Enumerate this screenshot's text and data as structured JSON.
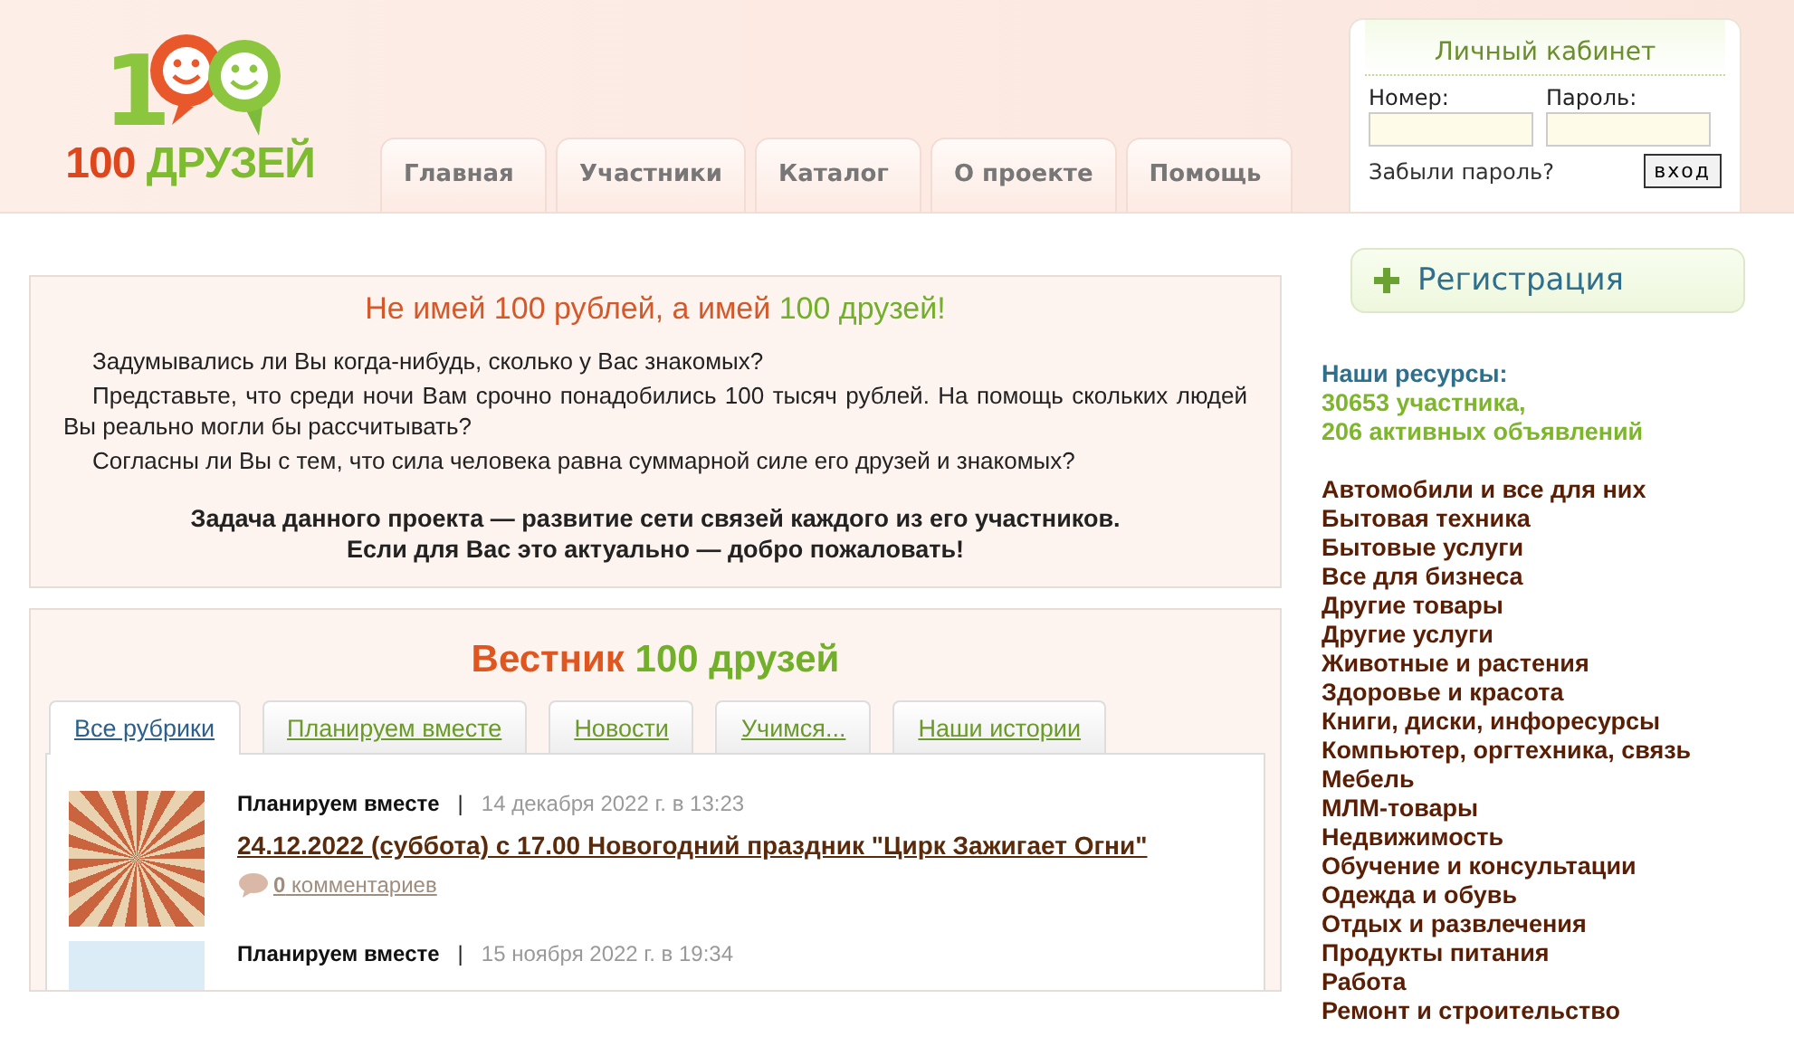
{
  "logo": {
    "mark": "1",
    "number": "100",
    "word": "ДРУЗЕЙ"
  },
  "nav": [
    {
      "label": "Главная",
      "selected": false
    },
    {
      "label": "Участники",
      "selected": false
    },
    {
      "label": "Каталог",
      "selected": false
    },
    {
      "label": "О проекте",
      "selected": false
    },
    {
      "label": "Помощь",
      "selected": false
    }
  ],
  "login": {
    "title": "Личный кабинет",
    "number_label": "Номер:",
    "password_label": "Пароль:",
    "forgot": "Забыли пароль?",
    "submit": "вход"
  },
  "intro": {
    "title": [
      {
        "kind": "accent",
        "text": "Не имей 100 рублей, а имей "
      },
      {
        "kind": "brand",
        "text": "100 друзей!"
      }
    ],
    "paragraphs": [
      "Задумывались ли Вы когда-нибудь, сколько у Вас знакомых?",
      "Представьте, что среди ночи Вам срочно понадобились 100 тысяч рублей. На помощь скольких людей Вы реально могли бы рассчитывать?",
      "Согласны ли Вы с тем, что сила человека равна суммарной силе его друзей и знакомых?"
    ],
    "mission": [
      "Задача данного проекта — развитие сети связей каждого из его участников.",
      "Если для Вас это актуально — добро пожаловать!"
    ]
  },
  "news": {
    "title": [
      {
        "kind": "accent",
        "text": "Вестник "
      },
      {
        "kind": "brand",
        "text": "100 друзей"
      }
    ],
    "tabs": [
      {
        "label": "Все рубрики",
        "selected": true
      },
      {
        "label": "Планируем вместе",
        "selected": false
      },
      {
        "label": "Новости",
        "selected": false
      },
      {
        "label": "Учимся...",
        "selected": false
      },
      {
        "label": "Наши истории",
        "selected": false
      }
    ],
    "items": [
      {
        "category": "Планируем вместе",
        "separator": "|",
        "date": "14 декабря 2022 г. в 13:23",
        "title": "24.12.2022 (суббота) с 17.00 Новогодний праздник \"Цирк Зажигает Огни\"",
        "comment_count": "0",
        "comment_word": " комментариев"
      },
      {
        "category": "Планируем вместе",
        "separator": "|",
        "date": "15 ноября 2022 г. в 19:34"
      }
    ]
  },
  "register": {
    "label": "Регистрация"
  },
  "resources": {
    "title": "Наши ресурсы:",
    "stats": [
      "30653 участника,",
      "206 активных объявлений"
    ],
    "categories": [
      "Автомобили и все для них",
      "Бытовая техника",
      "Бытовые услуги",
      "Все для бизнеса",
      "Другие товары",
      "Другие услуги",
      "Животные и растения",
      "Здоровье и красота",
      "Книги, диски, инфоресурсы",
      "Компьютер, оргтехника, связь",
      "Мебель",
      "МЛМ-товары",
      "Недвижимость",
      "Обучение и консультации",
      "Одежда и обувь",
      "Отдых и развлечения",
      "Продукты питания",
      "Работа",
      "Ремонт и строительство"
    ]
  }
}
